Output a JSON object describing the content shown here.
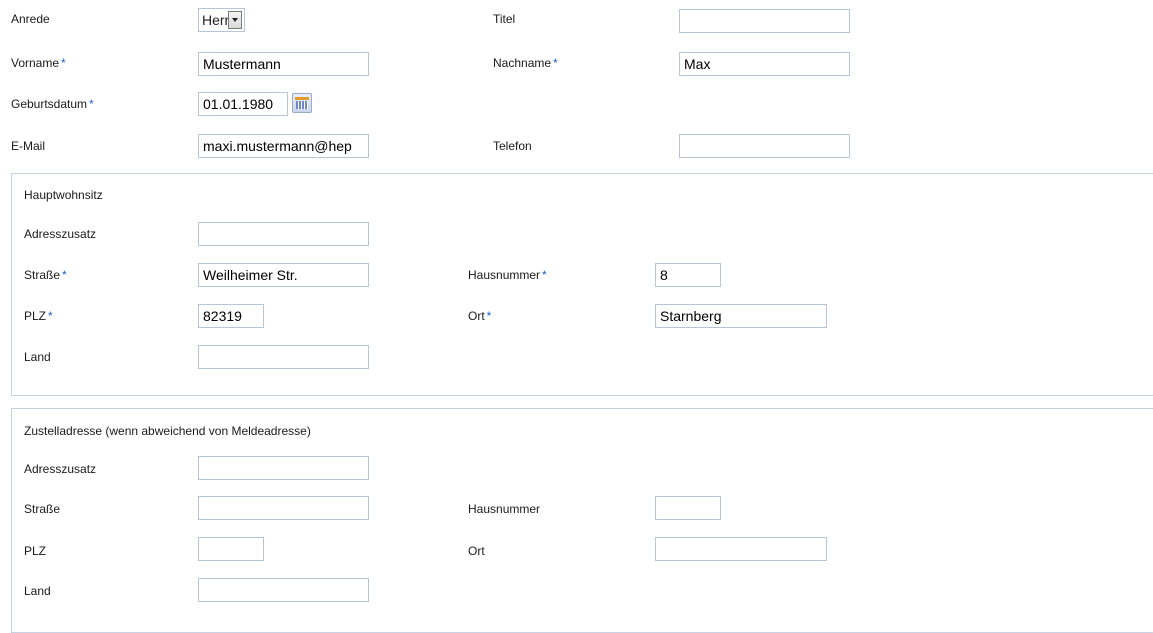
{
  "personal": {
    "anrede_label": "Anrede",
    "anrede_value": "Herr",
    "titel_label": "Titel",
    "titel_value": "",
    "vorname_label": "Vorname",
    "vorname_value": "Mustermann",
    "nachname_label": "Nachname",
    "nachname_value": "Max",
    "geburtsdatum_label": "Geburtsdatum",
    "geburtsdatum_value": "01.01.1980",
    "email_label": "E-Mail",
    "email_value": "maxi.mustermann@hep",
    "telefon_label": "Telefon",
    "telefon_value": ""
  },
  "required_marker": "*",
  "hauptwohnsitz": {
    "legend": "Hauptwohnsitz",
    "adresszusatz_label": "Adresszusatz",
    "adresszusatz_value": "",
    "strasse_label": "Straße",
    "strasse_value": "Weilheimer Str.",
    "hausnummer_label": "Hausnummer",
    "hausnummer_value": "8",
    "plz_label": "PLZ",
    "plz_value": "82319",
    "ort_label": "Ort",
    "ort_value": "Starnberg",
    "land_label": "Land",
    "land_value": ""
  },
  "zustelladresse": {
    "legend": "Zustelladresse (wenn abweichend von Meldeadresse)",
    "adresszusatz_label": "Adresszusatz",
    "adresszusatz_value": "",
    "strasse_label": "Straße",
    "strasse_value": "",
    "hausnummer_label": "Hausnummer",
    "hausnummer_value": "",
    "plz_label": "PLZ",
    "plz_value": "",
    "ort_label": "Ort",
    "ort_value": "",
    "land_label": "Land",
    "land_value": ""
  },
  "colors": {
    "required_marker": "#1b5fd1",
    "input_border": "#b8c5d6",
    "fieldset_border": "#c5d3e0"
  },
  "icons": {
    "date_picker": "calendar-icon",
    "select_arrow": "chevron-down-icon"
  }
}
